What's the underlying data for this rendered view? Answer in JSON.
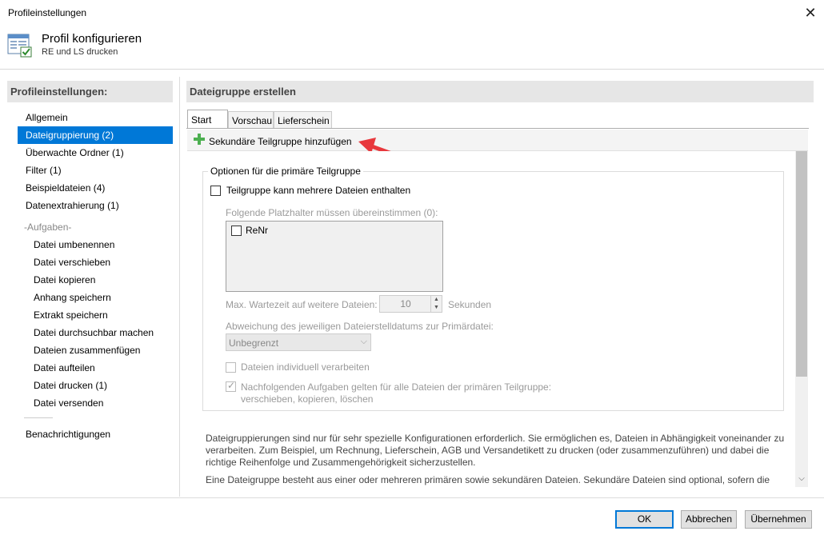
{
  "window": {
    "title": "Profileinstellungen",
    "close_icon": "close-icon"
  },
  "header": {
    "title": "Profil konfigurieren",
    "subtitle": "RE und LS drucken",
    "icon": "profile-window-icon"
  },
  "nav": {
    "heading": "Profileinstellungen:",
    "items": [
      {
        "label": "Allgemein",
        "active": false
      },
      {
        "label": "Dateigruppierung (2)",
        "active": true
      },
      {
        "label": "Überwachte Ordner (1)",
        "active": false
      },
      {
        "label": "Filter (1)",
        "active": false
      },
      {
        "label": "Beispieldateien (4)",
        "active": false
      },
      {
        "label": "Datenextrahierung (1)",
        "active": false
      }
    ],
    "group_label": "-Aufgaben-",
    "tasks": [
      "Datei umbenennen",
      "Datei verschieben",
      "Datei kopieren",
      "Anhang speichern",
      "Extrakt speichern",
      "Datei durchsuchbar machen",
      "Dateien zusammenfügen",
      "Datei aufteilen",
      "Datei drucken (1)",
      "Datei versenden"
    ],
    "notifications": "Benachrichtigungen"
  },
  "panel": {
    "heading": "Dateigruppe erstellen",
    "tabs": [
      "Start",
      "Vorschau",
      "Lieferschein"
    ],
    "active_tab": "Start",
    "add_link": "Sekundäre Teilgruppe hinzufügen",
    "accent_color": "#4caf50",
    "arrow_color": "#e8383d"
  },
  "primary_group": {
    "title": "Optionen für die primäre Teilgruppe",
    "multi_files_label": "Teilgruppe kann mehrere Dateien enthalten",
    "multi_files_checked": false,
    "placeholders_label": "Folgende Platzhalter müssen übereinstimmen (0):",
    "placeholders": [
      {
        "label": "ReNr",
        "checked": false
      }
    ],
    "max_wait_label": "Max. Wartezeit auf weitere Dateien:",
    "max_wait_value": "10",
    "max_wait_unit": "Sekunden",
    "date_dev_label": "Abweichung des jeweiligen Dateierstelldatums zur Primärdatei:",
    "date_dev_value": "Unbegrenzt",
    "individual_label": "Dateien individuell verarbeiten",
    "individual_checked": false,
    "following_line1": "Nachfolgenden Aufgaben gelten für alle Dateien der primären Teilgruppe:",
    "following_line2": "verschieben, kopieren, löschen",
    "following_checked": true
  },
  "description": {
    "line1": "Dateigruppierungen sind nur für sehr spezielle Konfigurationen erforderlich. Sie ermöglichen es, Dateien in Abhängigkeit voneinander zu",
    "line2": "verarbeiten. Zum Beispiel, um Rechnung, Lieferschein, AGB und Versandetikett zu drucken (oder zusammenzuführen) und dabei die",
    "line3": "richtige Reihenfolge und Zusammengehörigkeit sicherzustellen.",
    "line4": "Eine Dateigruppe besteht aus einer oder mehreren primären sowie sekundären Dateien. Sekundäre Dateien sind optional, sofern die"
  },
  "footer": {
    "ok": "OK",
    "cancel": "Abbrechen",
    "apply": "Übernehmen"
  }
}
